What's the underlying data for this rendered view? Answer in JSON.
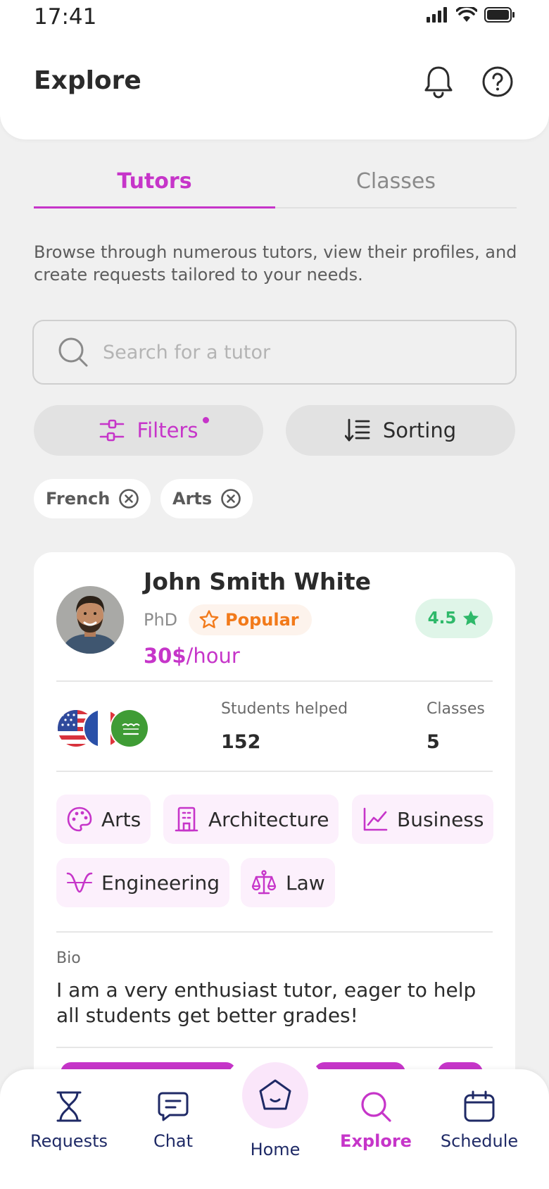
{
  "status_bar": {
    "time": "17:41"
  },
  "header": {
    "title": "Explore",
    "icons": [
      "bell-icon",
      "help-icon"
    ]
  },
  "tabs": [
    {
      "label": "Tutors",
      "active": true
    },
    {
      "label": "Classes",
      "active": false
    }
  ],
  "description": "Browse through numerous tutors, view their profiles, and create requests tailored to your needs.",
  "search": {
    "placeholder": "Search for a tutor",
    "value": ""
  },
  "controls": {
    "filters_label": "Filters",
    "filters_active": true,
    "sorting_label": "Sorting"
  },
  "active_filters": [
    {
      "label": "French"
    },
    {
      "label": "Arts"
    }
  ],
  "tutor": {
    "name": "John Smith White",
    "degree": "PhD",
    "badge": "Popular",
    "rating": "4.5",
    "price_amount": "30$",
    "price_unit": "/hour",
    "languages": [
      "us-flag",
      "fr-flag",
      "sa-flag"
    ],
    "stats": {
      "students_label": "Students helped",
      "students_value": "152",
      "classes_label": "Classes",
      "classes_value": "5"
    },
    "subjects": [
      {
        "label": "Arts",
        "icon": "palette-icon"
      },
      {
        "label": "Architecture",
        "icon": "building-icon"
      },
      {
        "label": "Business",
        "icon": "chart-icon"
      },
      {
        "label": "Engineering",
        "icon": "signal-wave-icon"
      },
      {
        "label": "Law",
        "icon": "scales-icon"
      }
    ],
    "bio_label": "Bio",
    "bio": "I am a very enthusiast tutor, eager to help all students get better grades!"
  },
  "nav": [
    {
      "label": "Requests",
      "icon": "hourglass-icon",
      "active": false
    },
    {
      "label": "Chat",
      "icon": "chat-icon",
      "active": false
    },
    {
      "label": "Home",
      "icon": "home-icon",
      "active": false
    },
    {
      "label": "Explore",
      "icon": "search-icon",
      "active": true
    },
    {
      "label": "Schedule",
      "icon": "calendar-icon",
      "active": false
    }
  ],
  "colors": {
    "accent": "#c635c9",
    "rating": "#2fb96a",
    "popular": "#f27a1a",
    "nav": "#1f2a66"
  }
}
